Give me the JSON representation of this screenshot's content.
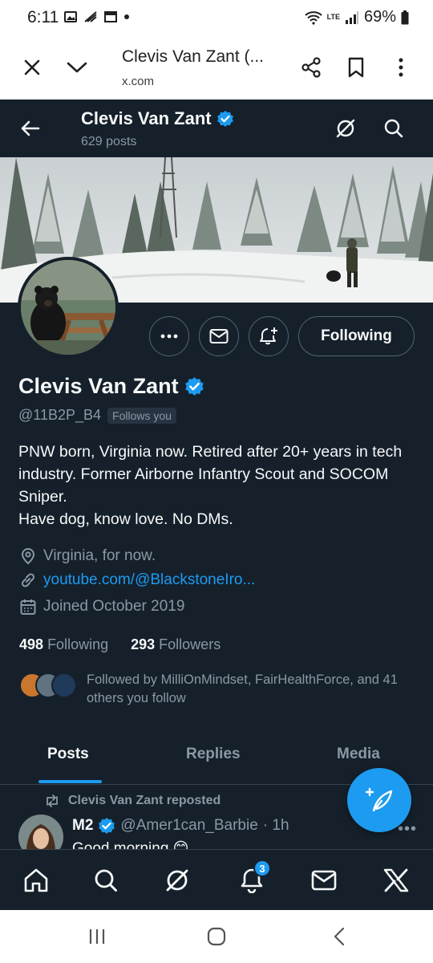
{
  "status_bar": {
    "time": "6:11",
    "battery": "69%",
    "network": "LTE"
  },
  "browser": {
    "title": "Clevis Van Zant (...",
    "url": "x.com"
  },
  "header": {
    "name": "Clevis Van Zant",
    "posts_count": "629 posts"
  },
  "profile": {
    "name": "Clevis Van Zant",
    "handle": "@11B2P_B4",
    "follows_you": "Follows you",
    "following_button": "Following",
    "bio_lines": [
      "PNW born, Virginia now. Retired after 20+ years in tech industry. Former Airborne Infantry Scout and SOCOM Sniper.",
      "Have dog, know love. No DMs."
    ],
    "location": "Virginia, for now.",
    "website": "youtube.com/@BlackstoneIro...",
    "joined": "Joined October 2019",
    "following_count": "498",
    "following_label": "Following",
    "followers_count": "293",
    "followers_label": "Followers",
    "followed_by": "Followed by MilliOnMindset, FairHealthForce, and 41 others you follow"
  },
  "tabs": [
    {
      "label": "Posts",
      "active": true
    },
    {
      "label": "Replies",
      "active": false
    },
    {
      "label": "Media",
      "active": false
    }
  ],
  "post": {
    "repost_label": "Clevis Van Zant reposted",
    "author_name": "M2",
    "author_handle": "@Amer1can_Barbie",
    "time": "· 1h",
    "text": "Good morning 😊"
  },
  "bottom_nav": {
    "notification_badge": "3"
  },
  "colors": {
    "background": "#15202b",
    "accent": "#1d9bf0",
    "text_primary": "#f7f9f9",
    "text_secondary": "#8b98a5"
  }
}
